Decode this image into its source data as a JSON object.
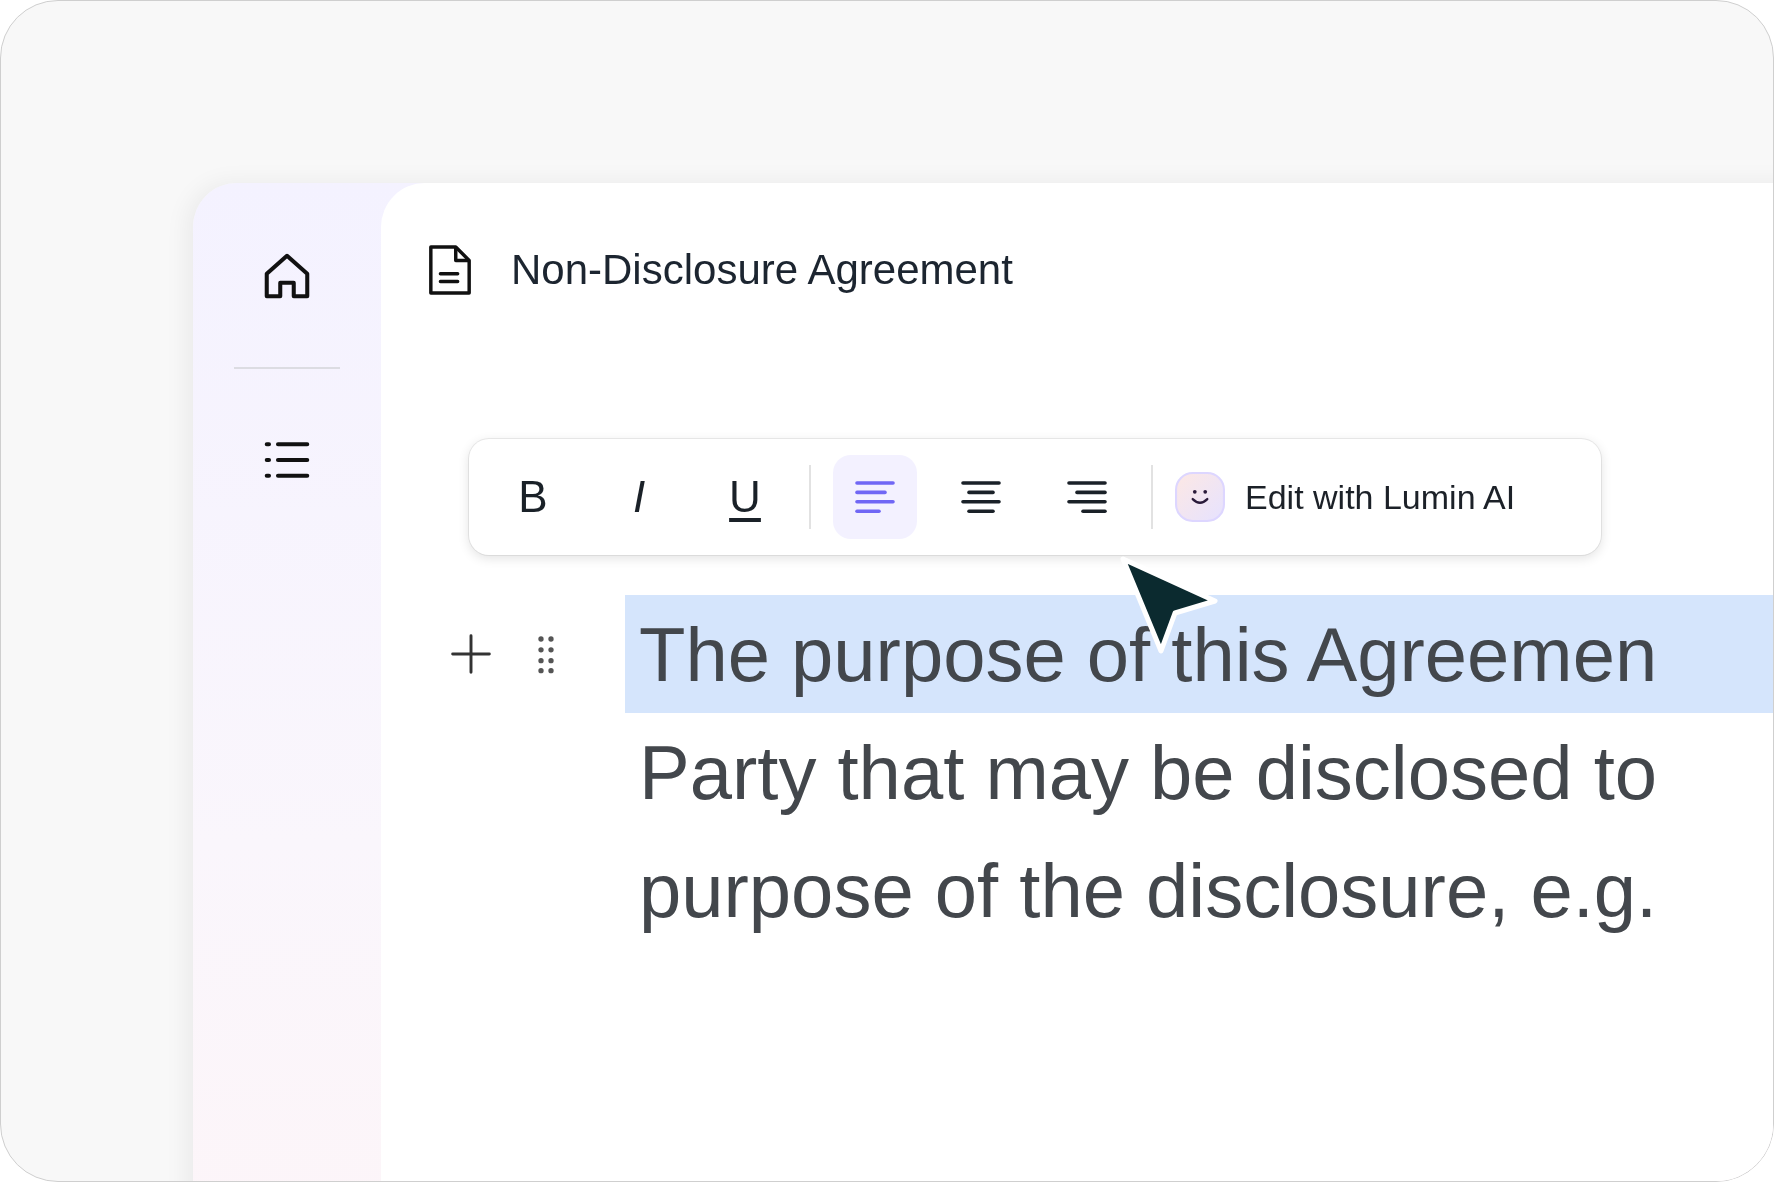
{
  "document": {
    "title": "Non-Disclosure Agreement"
  },
  "toolbar": {
    "format_buttons": [
      {
        "kind": "bold",
        "label": "B",
        "selected": false
      },
      {
        "kind": "italic",
        "label": "I",
        "selected": false
      },
      {
        "kind": "underline",
        "label": "U",
        "selected": false
      }
    ],
    "align_buttons": [
      {
        "kind": "left",
        "selected": true
      },
      {
        "kind": "center",
        "selected": false
      },
      {
        "kind": "right",
        "selected": false
      }
    ],
    "ai_button": {
      "label": "Edit with Lumin AI"
    }
  },
  "paragraph": {
    "lines": [
      {
        "text": "The purpose of this Agreemen",
        "selected": true
      },
      {
        "text": "Party that may be disclosed to",
        "selected": false
      },
      {
        "text": "purpose of the disclosure, e.g.",
        "selected": false
      }
    ]
  }
}
